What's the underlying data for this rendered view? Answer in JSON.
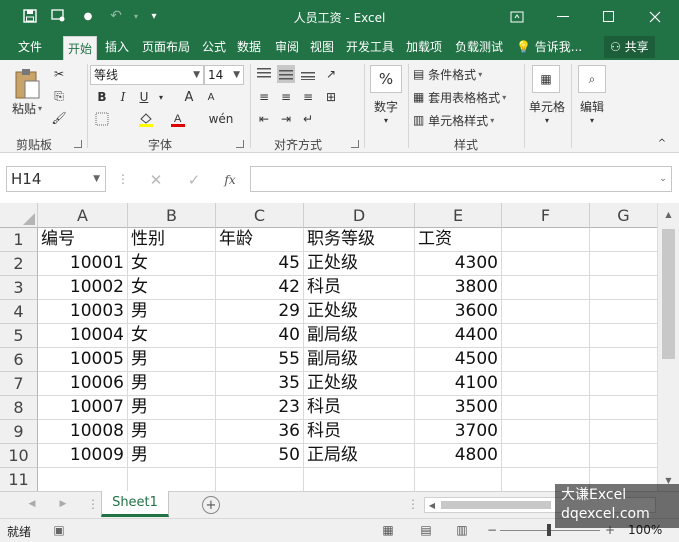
{
  "titlebar": {
    "title": "人员工资 - Excel",
    "save_icon": "save-icon",
    "touch_icon": "touch-mode-icon",
    "undo_icon": "undo-icon",
    "bg": "#217346"
  },
  "tabs": {
    "file": "文件",
    "home": "开始",
    "insert": "插入",
    "page_layout": "页面布局",
    "formulas": "公式",
    "data": "数据",
    "review": "审阅",
    "view": "视图",
    "developer": "开发工具",
    "addins": "加载项",
    "load_test": "负载测试",
    "tell_me": "告诉我...",
    "share": "共享"
  },
  "ribbon": {
    "clipboard": {
      "paste": "粘贴",
      "label": "剪贴板"
    },
    "font": {
      "name": "等线",
      "size": "14",
      "label": "字体",
      "bold": "B",
      "italic": "I",
      "underline": "U",
      "grow": "A",
      "shrink": "A"
    },
    "alignment": {
      "label": "对齐方式"
    },
    "number": {
      "percent": "%",
      "label": "数字"
    },
    "styles": {
      "conditional": "条件格式",
      "table": "套用表格格式",
      "cell": "单元格样式",
      "label": "样式"
    },
    "cells": {
      "label": "单元格"
    },
    "editing": {
      "label": "编辑"
    }
  },
  "formula_bar": {
    "name_box": "H14",
    "fx": "fx",
    "value": ""
  },
  "sheet": {
    "columns": [
      "A",
      "B",
      "C",
      "D",
      "E",
      "F",
      "G"
    ],
    "rows": [
      "1",
      "2",
      "3",
      "4",
      "5",
      "6",
      "7",
      "8",
      "9",
      "10",
      "11"
    ],
    "data": [
      [
        "编号",
        "性别",
        "年龄",
        "职务等级",
        "工资"
      ],
      [
        "10001",
        "女",
        "45",
        "正处级",
        "4300"
      ],
      [
        "10002",
        "女",
        "42",
        "科员",
        "3800"
      ],
      [
        "10003",
        "男",
        "29",
        "正处级",
        "3600"
      ],
      [
        "10004",
        "女",
        "40",
        "副局级",
        "4400"
      ],
      [
        "10005",
        "男",
        "55",
        "副局级",
        "4500"
      ],
      [
        "10006",
        "男",
        "35",
        "正处级",
        "4100"
      ],
      [
        "10007",
        "男",
        "23",
        "科员",
        "3500"
      ],
      [
        "10008",
        "男",
        "36",
        "科员",
        "3700"
      ],
      [
        "10009",
        "男",
        "50",
        "正局级",
        "4800"
      ],
      [
        "",
        "",
        "",
        "",
        ""
      ]
    ]
  },
  "sheet_tabs": {
    "active": "Sheet1"
  },
  "status": {
    "ready": "就绪",
    "zoom": "100%"
  },
  "watermark": {
    "line1": "大谦Excel",
    "line2": "dqexcel.com"
  }
}
